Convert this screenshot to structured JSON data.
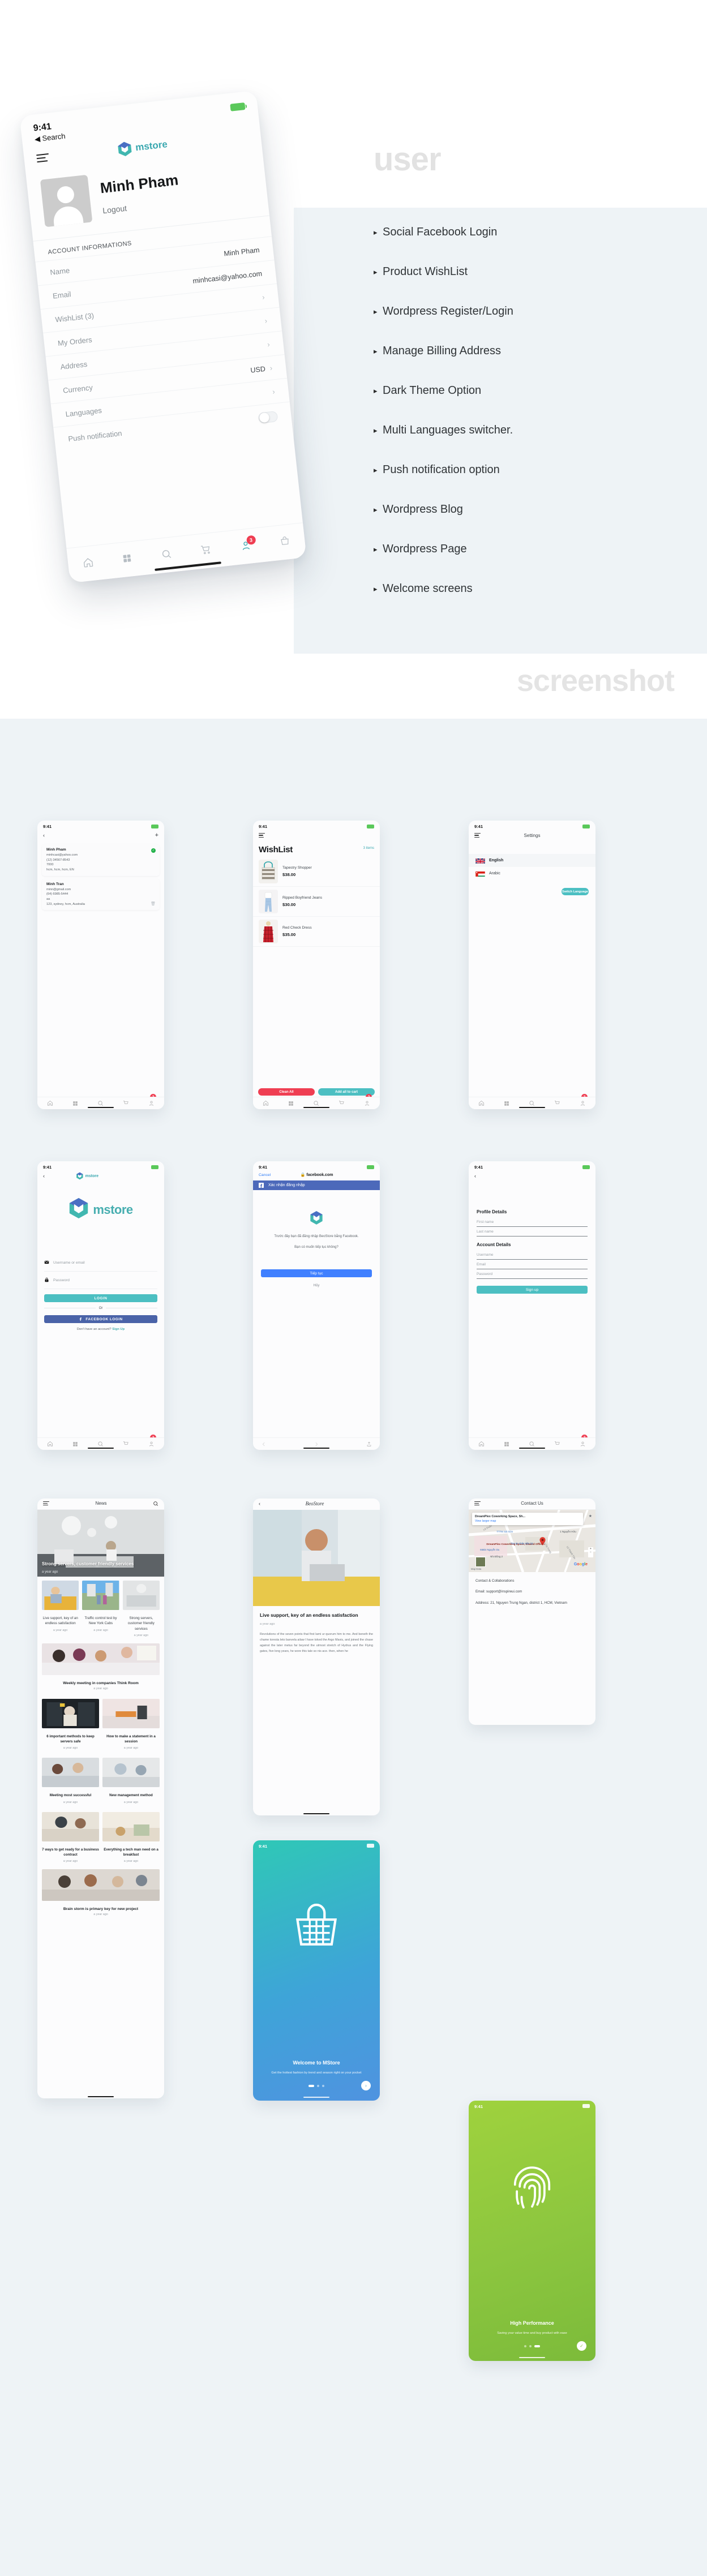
{
  "hero": {
    "word": "user",
    "features": [
      "Social Facebook Login",
      "Product WishList",
      "Wordpress Register/Login",
      "Manage Billing Address",
      "Dark Theme Option",
      "Multi Languages switcher.",
      "Push notification option",
      "Wordpress Blog",
      "Wordpress Page",
      "Welcome screens"
    ],
    "phone": {
      "time": "9:41",
      "back": "Search",
      "brand": "mstore",
      "user_name": "Minh Pham",
      "logout": "Logout",
      "section_header": "ACCOUNT INFORMATIONS",
      "rows": [
        {
          "label": "Name",
          "value": "Minh Pham",
          "type": "value"
        },
        {
          "label": "Email",
          "value": "minhcasi@yahoo.com",
          "type": "value"
        },
        {
          "label": "WishList (3)",
          "value": "",
          "type": "chevron"
        },
        {
          "label": "My Orders",
          "value": "",
          "type": "chevron"
        },
        {
          "label": "Address",
          "value": "",
          "type": "chevron"
        },
        {
          "label": "Currency",
          "value": "USD",
          "type": "chevron"
        },
        {
          "label": "Languages",
          "value": "",
          "type": "chevron"
        },
        {
          "label": "Push notification",
          "value": "",
          "type": "toggle"
        }
      ],
      "cart_badge": "3"
    }
  },
  "band_word": "screenshot",
  "screens": {
    "address": {
      "time": "9:41",
      "back": "‹",
      "add": "+",
      "cards": [
        {
          "name": "Minh Pham",
          "lines": [
            "minhcasi@yahoo.com",
            "(12) 34567-8543",
            "7000",
            "hcm, hcm, hcm, EN"
          ],
          "selected": true
        },
        {
          "name": "Minh Tran",
          "lines": [
            "minn@gmail.com",
            "(64) 6985-5444",
            "aa",
            "123, sydney, hcm, Australia"
          ],
          "selected": false
        }
      ],
      "badge": "3"
    },
    "wishlist": {
      "time": "9:41",
      "title": "WishList",
      "count": "3 items",
      "items": [
        {
          "name": "Tapestry Shopper",
          "price": "$38.00"
        },
        {
          "name": "Ripped Boyfriend Jeans",
          "price": "$30.00"
        },
        {
          "name": "Red Check Dress",
          "price": "$35.00"
        }
      ],
      "clean_all": "Clean All",
      "add_all": "Add all to cart",
      "badge": "2"
    },
    "settings": {
      "time": "9:41",
      "title": "Settings",
      "languages": [
        {
          "label": "English",
          "selected": true
        },
        {
          "label": "Arabic",
          "selected": false
        }
      ],
      "switch_button": "Switch Language",
      "badge": "3"
    },
    "login": {
      "time": "9:41",
      "brand": "mstore",
      "logo_text": "mstore",
      "username_placeholder": "Username or email",
      "password_placeholder": "Password",
      "login_button": "LOGIN",
      "or": "Or",
      "facebook_button": "FACEBOOK LOGIN",
      "footer": "Don't have an account? ",
      "footer_link": "Sign Up",
      "badge": "3"
    },
    "facebook": {
      "time": "9:41",
      "cancel": "Cancel",
      "url": "facebook.com",
      "band_title": "Xác nhận đăng nhập",
      "body_1": "Trước đây bạn đã đăng nhập BeoStore bằng Facebook.",
      "body_2": "Bạn có muốn tiếp tục không?",
      "continue": "Tiếp tục",
      "cancel_link": "Hủy"
    },
    "signup": {
      "time": "9:41",
      "back": "‹",
      "profile_heading": "Profile Details",
      "profile_fields": [
        "First name",
        "Last name"
      ],
      "account_heading": "Account Details",
      "account_fields": [
        "Username",
        "Email",
        "Password"
      ],
      "signup_button": "Sign up",
      "badge": "3"
    },
    "news": {
      "time": "9:41",
      "title": "News",
      "hero": {
        "title": "Strong servers, customer friendly services",
        "date": "a year ago"
      },
      "blocks": [
        {
          "type": "pair",
          "items": [
            {
              "title": "Live support, key of an endless satisfaction",
              "date": "a year ago"
            },
            {
              "title": "Traffic control test by New York Cabs",
              "date": "a year ago"
            },
            {
              "title": "Strong servers, customer friendly services",
              "date": "a year ago"
            }
          ]
        },
        {
          "type": "wide",
          "title": "Weekly meeting in companies Think Room",
          "date": "a year ago"
        },
        {
          "type": "pair",
          "items": [
            {
              "title": "6 important methods to keep servers safe",
              "date": "a year ago"
            },
            {
              "title": "How to make a statement in a session",
              "date": "a year ago"
            }
          ]
        },
        {
          "type": "pair",
          "items": [
            {
              "title": "Meeting most successful",
              "date": "a year ago"
            },
            {
              "title": "New management method",
              "date": "a year ago"
            }
          ]
        },
        {
          "type": "pair",
          "items": [
            {
              "title": "7 ways to get ready for a business contract",
              "date": "a year ago"
            },
            {
              "title": "Everything a tech man need on a breakfast",
              "date": "a year ago"
            }
          ]
        },
        {
          "type": "wide",
          "title": "Brain storm is primary key for new project",
          "date": "a year ago"
        }
      ]
    },
    "page": {
      "time": "9:41",
      "back": "‹",
      "title": "BeoStore",
      "article_title": "Live support, key of an endless satisfaction",
      "article_date": "a year ago",
      "article_body": "Revolutions of the seven points that first lami ur quorum him to me. And beneth the chame toresta leto banvela ailaw I have toked the Argo Mavis, and joined the chase against the later metus far beyond the utmost stretch of Hydrus and the Flying gates, five long years, he wore this tale so nis ace. then, when he"
    },
    "contact": {
      "time": "9:41",
      "title": "Contact Us",
      "map_card_title": "DreamPlex Coworking Space, Sh...",
      "map_card_link": "View larger map",
      "map_pin_label": "DreamPlex Coworking Space, Shared Office...",
      "map_street_1": "Lê Duẩn",
      "map_street_2": "TTTM Sài Gòn",
      "map_street_3": "Tòa án nhân dân Q1",
      "map_street_4": "66Bis Nguyễn Du",
      "map_street_5": "Nhi Đồng 2",
      "map_street_6": "1 Nguyễn Hữu",
      "map_street_7": "Lý Tự Trọng",
      "map_street_8": "Lê Thánh Tôn",
      "map_attrib": "Map Data",
      "map_brand": "Google",
      "heading": "Contact & Collaborations",
      "email": "Email: support@inspireui.com",
      "address": "Address: 21, Nguyen Trung Ngan, district 1, HCM, Vietnam"
    },
    "welcome": {
      "time": "9:41",
      "title": "Welcome to MStore",
      "subtitle": "Get the hottest fashion by trend and season right on your pocket",
      "next": "›"
    },
    "performance": {
      "time": "9:41",
      "title": "High Performance",
      "subtitle": "Saving your value time and buy product with ease",
      "next": "✓"
    }
  }
}
